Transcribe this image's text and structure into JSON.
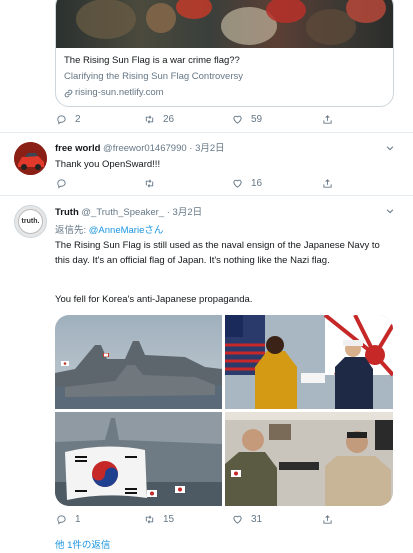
{
  "link_card": {
    "title": "The Rising Sun Flag is a war crime flag??",
    "description": "Clarifying the Rising Sun Flag Controversy",
    "domain": "rising-sun.netlify.com",
    "domain_icon": "link-icon"
  },
  "tweet1": {
    "replies": "2",
    "retweets": "26",
    "likes": "59"
  },
  "tweet2": {
    "name": "free world",
    "handle": "@freewor01467990",
    "separator": "·",
    "date": "3月2日",
    "text": "Thank you OpenSward!!!",
    "replies": "",
    "retweets": "",
    "likes": "16"
  },
  "tweet3": {
    "name": "Truth",
    "handle": "@_Truth_Speaker_",
    "separator": "·",
    "date": "3月2日",
    "reply_prefix": "返信先: ",
    "reply_mention": "@AnneMarieさん",
    "text_p1": "The Rising Sun Flag is still used as the naval ensign of the Japanese Navy to this day. It's an official flag of Japan. It's nothing like the Nazi flag.",
    "text_p2": "You fell for Korea's anti-Japanese propaganda.",
    "replies": "1",
    "retweets": "15",
    "likes": "31",
    "avatar_text": "truth.",
    "show_more": "他 1件の返信"
  },
  "colors": {
    "accent": "#1b95e0",
    "muted": "#657786",
    "border": "#e6ecf0",
    "text": "#14171a"
  }
}
